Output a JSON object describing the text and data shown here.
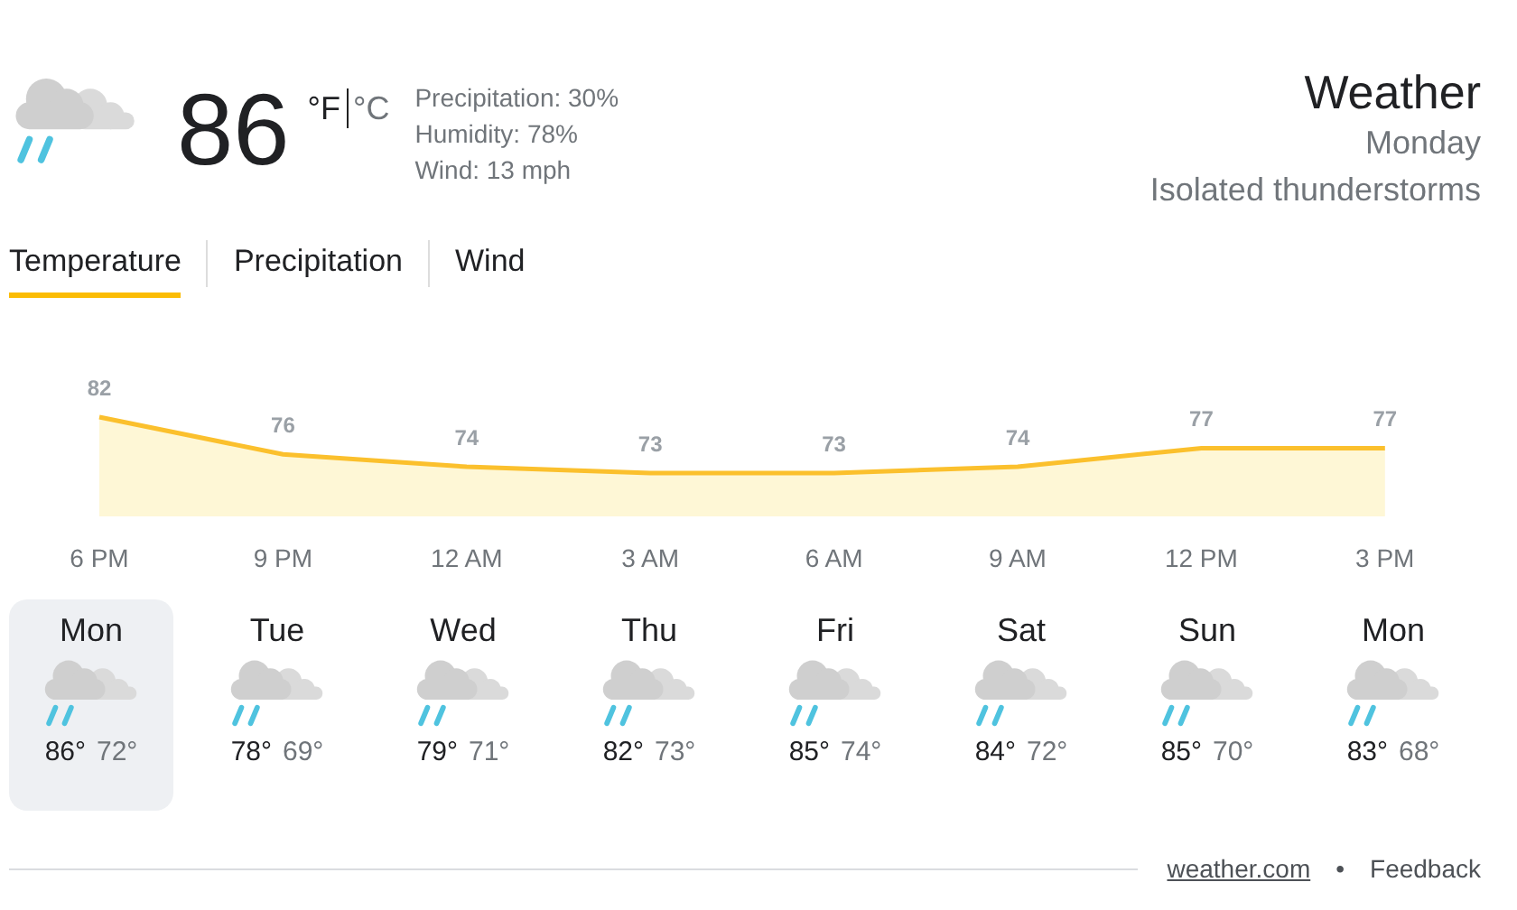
{
  "current": {
    "temperature": "86",
    "units": [
      {
        "label": "°F",
        "selected": true
      },
      {
        "label": "°C",
        "selected": false
      }
    ],
    "details": [
      "Precipitation: 30%",
      "Humidity: 78%",
      "Wind: 13 mph"
    ]
  },
  "header": {
    "title": "Weather",
    "day": "Monday",
    "condition": "Isolated thunderstorms"
  },
  "tabs": [
    {
      "label": "Temperature",
      "selected": true
    },
    {
      "label": "Precipitation",
      "selected": false
    },
    {
      "label": "Wind",
      "selected": false
    }
  ],
  "chart": {
    "chart_data": {
      "type": "area",
      "categories": [
        "6 PM",
        "9 PM",
        "12 AM",
        "3 AM",
        "6 AM",
        "9 AM",
        "12 PM",
        "3 PM"
      ],
      "values": [
        82,
        76,
        74,
        73,
        73,
        74,
        77,
        77
      ],
      "data_labels": true
    }
  },
  "days": [
    {
      "name": "Mon",
      "high": "86°",
      "low": "72°",
      "selected": true
    },
    {
      "name": "Tue",
      "high": "78°",
      "low": "69°",
      "selected": false
    },
    {
      "name": "Wed",
      "high": "79°",
      "low": "71°",
      "selected": false
    },
    {
      "name": "Thu",
      "high": "82°",
      "low": "73°",
      "selected": false
    },
    {
      "name": "Fri",
      "high": "85°",
      "low": "74°",
      "selected": false
    },
    {
      "name": "Sat",
      "high": "84°",
      "low": "72°",
      "selected": false
    },
    {
      "name": "Sun",
      "high": "85°",
      "low": "70°",
      "selected": false
    },
    {
      "name": "Mon",
      "high": "83°",
      "low": "68°",
      "selected": false
    }
  ],
  "footer": {
    "source": "weather.com",
    "separator": "•",
    "feedback": "Feedback"
  }
}
